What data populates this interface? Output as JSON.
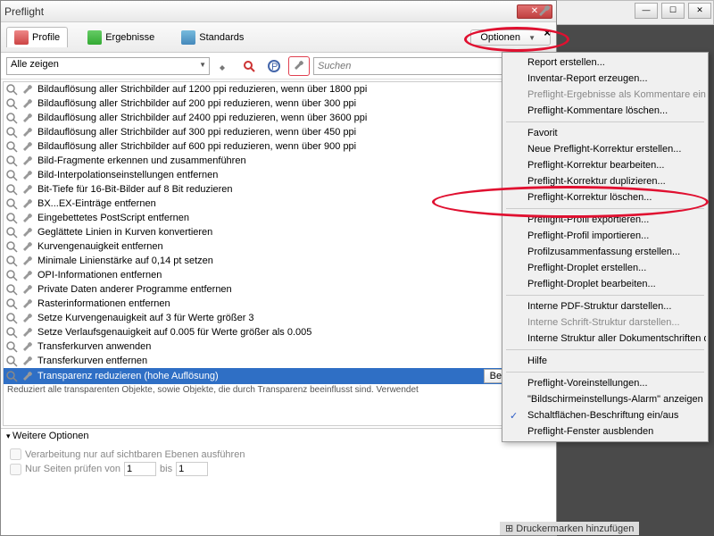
{
  "title": "Preflight",
  "tabs": {
    "profile": "Profile",
    "results": "Ergebnisse",
    "standards": "Standards"
  },
  "options_btn": "Optionen",
  "filter": "Alle zeigen",
  "search_ph": "Suchen",
  "edit_btn": "Bearbeiten...",
  "items": [
    "Bildauflösung aller Strichbilder auf 1200 ppi reduzieren, wenn über 1800 ppi",
    "Bildauflösung aller Strichbilder auf 200 ppi reduzieren, wenn über 300 ppi",
    "Bildauflösung aller Strichbilder auf 2400 ppi reduzieren, wenn über 3600 ppi",
    "Bildauflösung aller Strichbilder auf 300 ppi reduzieren, wenn über 450 ppi",
    "Bildauflösung aller Strichbilder auf 600 ppi reduzieren, wenn über 900 ppi",
    "Bild-Fragmente erkennen und zusammenführen",
    "Bild-Interpolationseinstellungen entfernen",
    "Bit-Tiefe für 16-Bit-Bilder auf 8 Bit reduzieren",
    "BX...EX-Einträge entfernen",
    "Eingebettetes PostScript entfernen",
    "Geglättete Linien in Kurven konvertieren",
    "Kurvengenauigkeit entfernen",
    "Minimale Linienstärke auf 0,14 pt setzen",
    "OPI-Informationen entfernen",
    "Private Daten anderer Programme entfernen",
    "Rasterinformationen entfernen",
    "Setze Kurvengenauigkeit auf 3 für Werte größer 3",
    "Setze Verlaufsgenauigkeit auf 0.005 für Werte größer als 0.005",
    "Transferkurven anwenden",
    "Transferkurven entfernen",
    "Transparenz reduzieren (hohe Auflösung)"
  ],
  "desc": "Reduziert alle transparenten Objekte, sowie Objekte, die durch Transparenz beeinflusst sind. Verwendet",
  "expander": "Weitere Optionen",
  "chk1": "Verarbeitung nur auf sichtbaren Ebenen ausführen",
  "chk2": "Nur Seiten prüfen von",
  "bis": "bis",
  "page_from": "1",
  "page_to": "1",
  "menu": {
    "report": "Report erstellen...",
    "inventory": "Inventar-Report erzeugen...",
    "results_comments": "Preflight-Ergebnisse als Kommentare einf",
    "del_comments": "Preflight-Kommentare löschen...",
    "favorite": "Favorit",
    "new_fix": "Neue Preflight-Korrektur erstellen...",
    "edit_fix": "Preflight-Korrektur bearbeiten...",
    "dup_fix": "Preflight-Korrektur duplizieren...",
    "del_fix": "Preflight-Korrektur löschen...",
    "export_profile": "Preflight-Profil exportieren...",
    "import_profile": "Preflight-Profil importieren...",
    "summary": "Profilzusammenfassung erstellen...",
    "create_droplet": "Preflight-Droplet erstellen...",
    "edit_droplet": "Preflight-Droplet bearbeiten...",
    "pdf_struct": "Interne PDF-Struktur darstellen...",
    "font_struct": "Interne Schrift-Struktur darstellen...",
    "doc_fonts": "Interne Struktur aller Dokumentschriften d",
    "help": "Hilfe",
    "prefs": "Preflight-Voreinstellungen...",
    "alarm": "\"Bildschirmeinstellungs-Alarm\" anzeigen",
    "labels": "Schaltflächen-Beschriftung ein/aus",
    "hide": "Preflight-Fenster ausblenden"
  },
  "footer": "Druckermarken hinzufügen"
}
